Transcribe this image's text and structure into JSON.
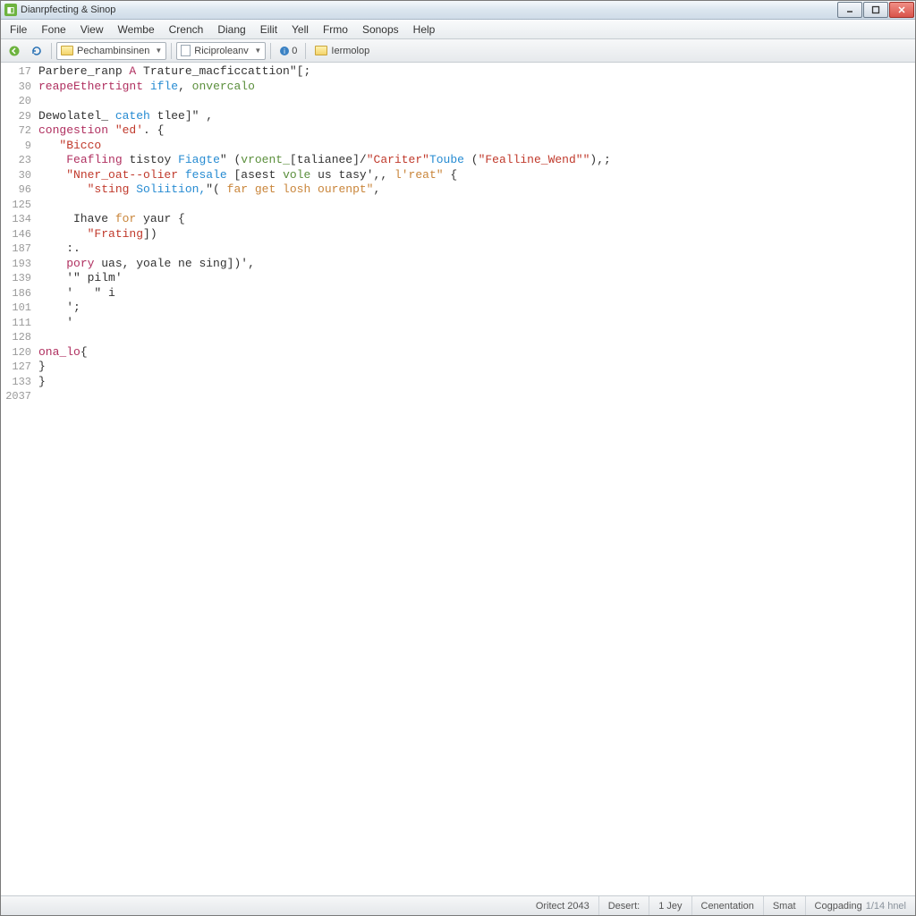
{
  "title": "Dianrpfecting & Sinop",
  "menu": [
    "File",
    "Fone",
    "View",
    "Wembe",
    "Crench",
    "Diang",
    "Eilit",
    "Yell",
    "Frmo",
    "Sonops",
    "Help"
  ],
  "toolbar": {
    "combo1": "Pechambinsinen",
    "combo2": "Riciproleanv",
    "badge": "0",
    "combo3": "Iermolop"
  },
  "gutter": [
    "17",
    "30",
    "20",
    "29",
    "72",
    "9",
    "23",
    "30",
    "96",
    "125",
    "134",
    "146",
    "187",
    "193",
    "139",
    "186",
    "101",
    "111",
    "128",
    "120",
    "127",
    "133",
    "2037"
  ],
  "code": [
    [
      {
        "c": "pl",
        "t": "Parbere_ranp "
      },
      {
        "c": "kw",
        "t": "A"
      },
      {
        "c": "pl",
        "t": " Trature_macficcattion\"[;"
      }
    ],
    [
      {
        "c": "kw",
        "t": "reapeEthertignt"
      },
      {
        "c": "pl",
        "t": " "
      },
      {
        "c": "kw2",
        "t": "ifle"
      },
      {
        "c": "pl",
        "t": ", "
      },
      {
        "c": "id",
        "t": "onvercalo"
      }
    ],
    [],
    [
      {
        "c": "pl",
        "t": "Dewolatel_ "
      },
      {
        "c": "kw2",
        "t": "cateh"
      },
      {
        "c": "pl",
        "t": " tlee]\" ,"
      }
    ],
    [
      {
        "c": "kw",
        "t": "congestion"
      },
      {
        "c": "pl",
        "t": " "
      },
      {
        "c": "str",
        "t": "\"ed'"
      },
      {
        "c": "pl",
        "t": ". {"
      }
    ],
    [
      {
        "c": "pl",
        "t": "   "
      },
      {
        "c": "str",
        "t": "\"Bicco"
      }
    ],
    [
      {
        "c": "pl",
        "t": "    "
      },
      {
        "c": "kw",
        "t": "Feafling"
      },
      {
        "c": "pl",
        "t": " tistoy "
      },
      {
        "c": "kw2",
        "t": "Fiagte"
      },
      {
        "c": "pl",
        "t": "\" ("
      },
      {
        "c": "id",
        "t": "vroent_"
      },
      {
        "c": "pl",
        "t": "[talianee]/"
      },
      {
        "c": "str",
        "t": "\"Cariter\""
      },
      {
        "c": "kw2",
        "t": "Toube"
      },
      {
        "c": "pl",
        "t": " ("
      },
      {
        "c": "str",
        "t": "\"Fealline_Wend\"\""
      },
      {
        "c": "pl",
        "t": "),;"
      }
    ],
    [
      {
        "c": "pl",
        "t": "    "
      },
      {
        "c": "str",
        "t": "\"Nner_oat--olier"
      },
      {
        "c": "pl",
        "t": " "
      },
      {
        "c": "kw2",
        "t": "fesale"
      },
      {
        "c": "pl",
        "t": " [asest "
      },
      {
        "c": "id",
        "t": "vole"
      },
      {
        "c": "pl",
        "t": " us tasy',, "
      },
      {
        "c": "cm",
        "t": "l'reat\""
      },
      {
        "c": "pl",
        "t": " {"
      }
    ],
    [
      {
        "c": "pl",
        "t": "       "
      },
      {
        "c": "str",
        "t": "\"sting "
      },
      {
        "c": "kw2",
        "t": "Soliition,"
      },
      {
        "c": "pl",
        "t": "\"( "
      },
      {
        "c": "cm",
        "t": "far get losh ourenpt\""
      },
      {
        "c": "pl",
        "t": ","
      }
    ],
    [],
    [
      {
        "c": "pl",
        "t": "     Ihave "
      },
      {
        "c": "cm",
        "t": "for"
      },
      {
        "c": "pl",
        "t": " yaur {"
      }
    ],
    [
      {
        "c": "pl",
        "t": "       "
      },
      {
        "c": "str",
        "t": "\"Frating"
      },
      {
        "c": "pl",
        "t": "])"
      }
    ],
    [
      {
        "c": "pl",
        "t": "    :."
      }
    ],
    [
      {
        "c": "pl",
        "t": "    "
      },
      {
        "c": "kw",
        "t": "pory"
      },
      {
        "c": "pl",
        "t": " uas, yoale ne sing])',"
      }
    ],
    [
      {
        "c": "pl",
        "t": "    '\" pilm'"
      }
    ],
    [
      {
        "c": "pl",
        "t": "    '   \" i"
      }
    ],
    [
      {
        "c": "pl",
        "t": "    ';"
      }
    ],
    [
      {
        "c": "pl",
        "t": "    '"
      }
    ],
    [],
    [
      {
        "c": "kw",
        "t": "ona_lo"
      },
      {
        "c": "pl",
        "t": "{"
      }
    ],
    [
      {
        "c": "pl",
        "t": "}"
      }
    ],
    [
      {
        "c": "pl",
        "t": "}"
      }
    ],
    []
  ],
  "status": {
    "left": "Oritect 2043",
    "desert_label": "Desert:",
    "ljey": "1 Jey",
    "centation": "Cenentation",
    "smat": "Smat",
    "cogpading": "Cogpading",
    "hnel": "1/14 hnel"
  }
}
